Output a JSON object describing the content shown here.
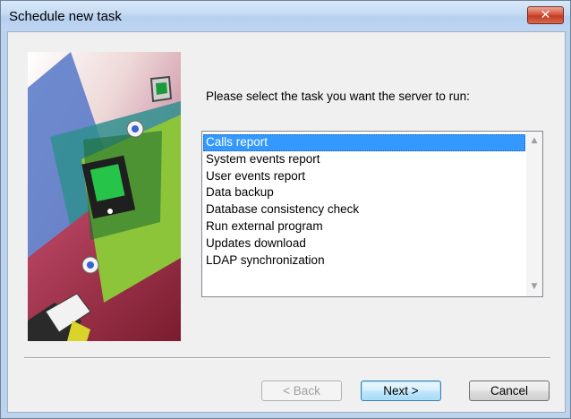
{
  "window": {
    "title": "Schedule new task"
  },
  "titlebar": {
    "close_icon": "close-icon",
    "close_glyph": "✕"
  },
  "wizard": {
    "image": "wizard-illustration",
    "prompt": "Please select the task you want the server to run:"
  },
  "task_list": {
    "selected_index": 0,
    "items": [
      "Calls report",
      "System events report",
      "User events report",
      "Data backup",
      "Database consistency check",
      "Run external program",
      "Updates download",
      "LDAP synchronization"
    ]
  },
  "buttons": {
    "back": "< Back",
    "next": "Next >",
    "cancel": "Cancel"
  },
  "colors": {
    "selection": "#3399ff",
    "title_gradient": "#c4daf3",
    "close_button": "#c94a32"
  }
}
